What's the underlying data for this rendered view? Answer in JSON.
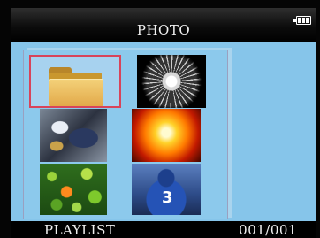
{
  "header": {
    "title": "PHOTO",
    "battery_icon": "battery-full-icon"
  },
  "grid": {
    "items": [
      {
        "name": "folder",
        "icon": "folder-icon",
        "selected": true
      },
      {
        "name": "dandelion",
        "icon": "image-thumbnail",
        "selected": false
      },
      {
        "name": "football-players",
        "icon": "image-thumbnail",
        "selected": false
      },
      {
        "name": "fire-burst",
        "icon": "image-thumbnail",
        "selected": false
      },
      {
        "name": "clownfish",
        "icon": "image-thumbnail",
        "selected": false
      },
      {
        "name": "football-player-3",
        "icon": "image-thumbnail",
        "selected": false,
        "overlay_text": "3"
      }
    ]
  },
  "footer": {
    "left_label": "PLAYLIST",
    "page_counter": "001/001"
  },
  "colors": {
    "background": "#000000",
    "panel": "#86c5ea",
    "selection": "#d8445a",
    "text": "#f2f2f2"
  }
}
